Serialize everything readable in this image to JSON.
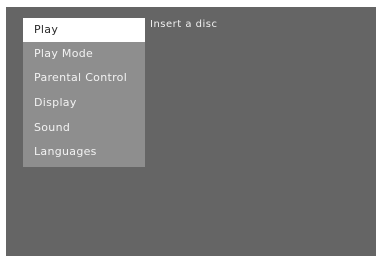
{
  "menu": {
    "items": [
      {
        "label": "Play",
        "selected": true
      },
      {
        "label": "Play Mode",
        "selected": false
      },
      {
        "label": "Parental Control",
        "selected": false
      },
      {
        "label": "Display",
        "selected": false
      },
      {
        "label": "Sound",
        "selected": false
      },
      {
        "label": "Languages",
        "selected": false
      }
    ]
  },
  "status": {
    "message": "Insert a disc"
  },
  "colors": {
    "screen_background": "#656565",
    "menu_background": "#8e8e8e",
    "selected_background": "#ffffff",
    "selected_text": "#2a2a2a",
    "menu_text": "#f2f2f2"
  }
}
